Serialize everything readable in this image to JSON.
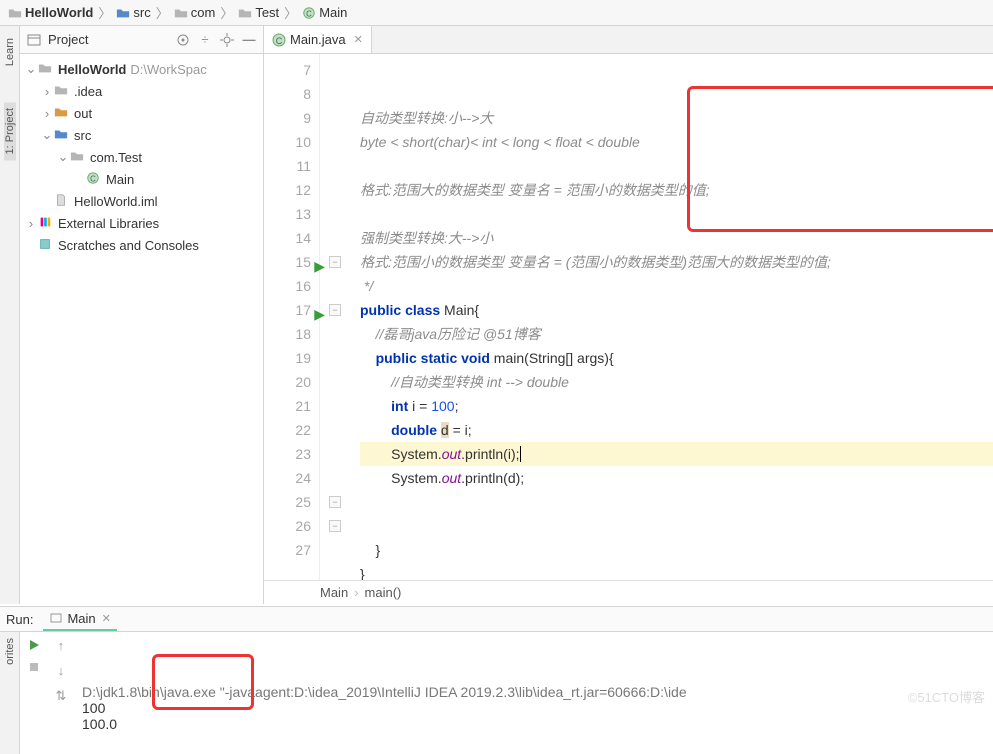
{
  "breadcrumb": [
    {
      "icon": "folder",
      "label": "HelloWorld",
      "bold": true
    },
    {
      "icon": "folder-b",
      "label": "src"
    },
    {
      "icon": "folder",
      "label": "com"
    },
    {
      "icon": "folder",
      "label": "Test"
    },
    {
      "icon": "class",
      "label": "Main"
    }
  ],
  "leftrail": {
    "learn": "Learn",
    "project": "1: Project"
  },
  "project": {
    "title": "Project",
    "tree": [
      {
        "ind": 0,
        "arrow": "v",
        "icon": "folder",
        "label": "HelloWorld",
        "bold": true,
        "gray": "D:\\WorkSpac"
      },
      {
        "ind": 1,
        "arrow": ">",
        "icon": "folder",
        "label": ".idea"
      },
      {
        "ind": 1,
        "arrow": ">",
        "icon": "folder-o",
        "label": "out"
      },
      {
        "ind": 1,
        "arrow": "v",
        "icon": "folder-b",
        "label": "src"
      },
      {
        "ind": 2,
        "arrow": "v",
        "icon": "folder",
        "label": "com.Test"
      },
      {
        "ind": 3,
        "arrow": " ",
        "icon": "class",
        "label": "Main"
      },
      {
        "ind": 1,
        "arrow": " ",
        "icon": "file",
        "label": "HelloWorld.iml"
      },
      {
        "ind": 0,
        "arrow": ">",
        "icon": "lib",
        "label": "External Libraries"
      },
      {
        "ind": 0,
        "arrow": " ",
        "icon": "scratch",
        "label": "Scratches and Consoles"
      }
    ]
  },
  "editor": {
    "tab": {
      "label": "Main.java"
    },
    "lines": [
      {
        "n": 7,
        "html": "<span class='com'>自动类型转换:小--&gt;大</span>"
      },
      {
        "n": 8,
        "html": "<span class='com'>byte &lt; short(char)&lt; int &lt; long &lt; float &lt; double</span>"
      },
      {
        "n": 9,
        "html": ""
      },
      {
        "n": 10,
        "html": "<span class='com'>格式:范围大的数据类型 变量名 = 范围小的数据类型的值;</span>"
      },
      {
        "n": 11,
        "html": ""
      },
      {
        "n": 12,
        "html": "<span class='com'>强制类型转换:大--&gt;小</span>"
      },
      {
        "n": 13,
        "html": "<span class='com'>格式:范围小的数据类型 变量名 = (范围小的数据类型)范围大的数据类型的值;</span>"
      },
      {
        "n": 14,
        "html": "<span class='com'> */</span>"
      },
      {
        "n": 15,
        "html": "<span class='kw'>public class</span> Main{",
        "run": true,
        "fold": "-"
      },
      {
        "n": 16,
        "html": "    <span class='com'>//磊哥java历险记 @51博客</span>"
      },
      {
        "n": 17,
        "html": "    <span class='kw'>public static void</span> main(String[] args){",
        "run": true,
        "fold": "-"
      },
      {
        "n": 18,
        "html": "        <span class='com'>//自动类型转换 int --&gt; double</span>"
      },
      {
        "n": 19,
        "html": "        <span class='kw'>int</span> i = <span class='num'>100</span>;"
      },
      {
        "n": 20,
        "html": "        <span class='kw'>double</span> <span style='background:#e8dcc3'>d</span> = i;"
      },
      {
        "n": 21,
        "html": "        System.<span class='fld'>out</span>.println(i)<span class='cursor'>;</span>",
        "hl": true
      },
      {
        "n": 22,
        "html": "        System.<span class='fld'>out</span>.println(d);"
      },
      {
        "n": 23,
        "html": ""
      },
      {
        "n": 24,
        "html": ""
      },
      {
        "n": 25,
        "html": "    }",
        "fold": "-"
      },
      {
        "n": 26,
        "html": "}",
        "fold": "-"
      },
      {
        "n": 27,
        "html": ""
      }
    ],
    "crumb": [
      "Main",
      "main()"
    ]
  },
  "run": {
    "label": "Run:",
    "tab": "Main",
    "sideLabel": "orites",
    "output": [
      "D:\\jdk1.8\\bin\\java.exe \"-javaagent:D:\\idea_2019\\IntelliJ IDEA 2019.2.3\\lib\\idea_rt.jar=60666:D:\\ide",
      "100",
      "100.0"
    ]
  },
  "watermark": "©51CTO博客"
}
